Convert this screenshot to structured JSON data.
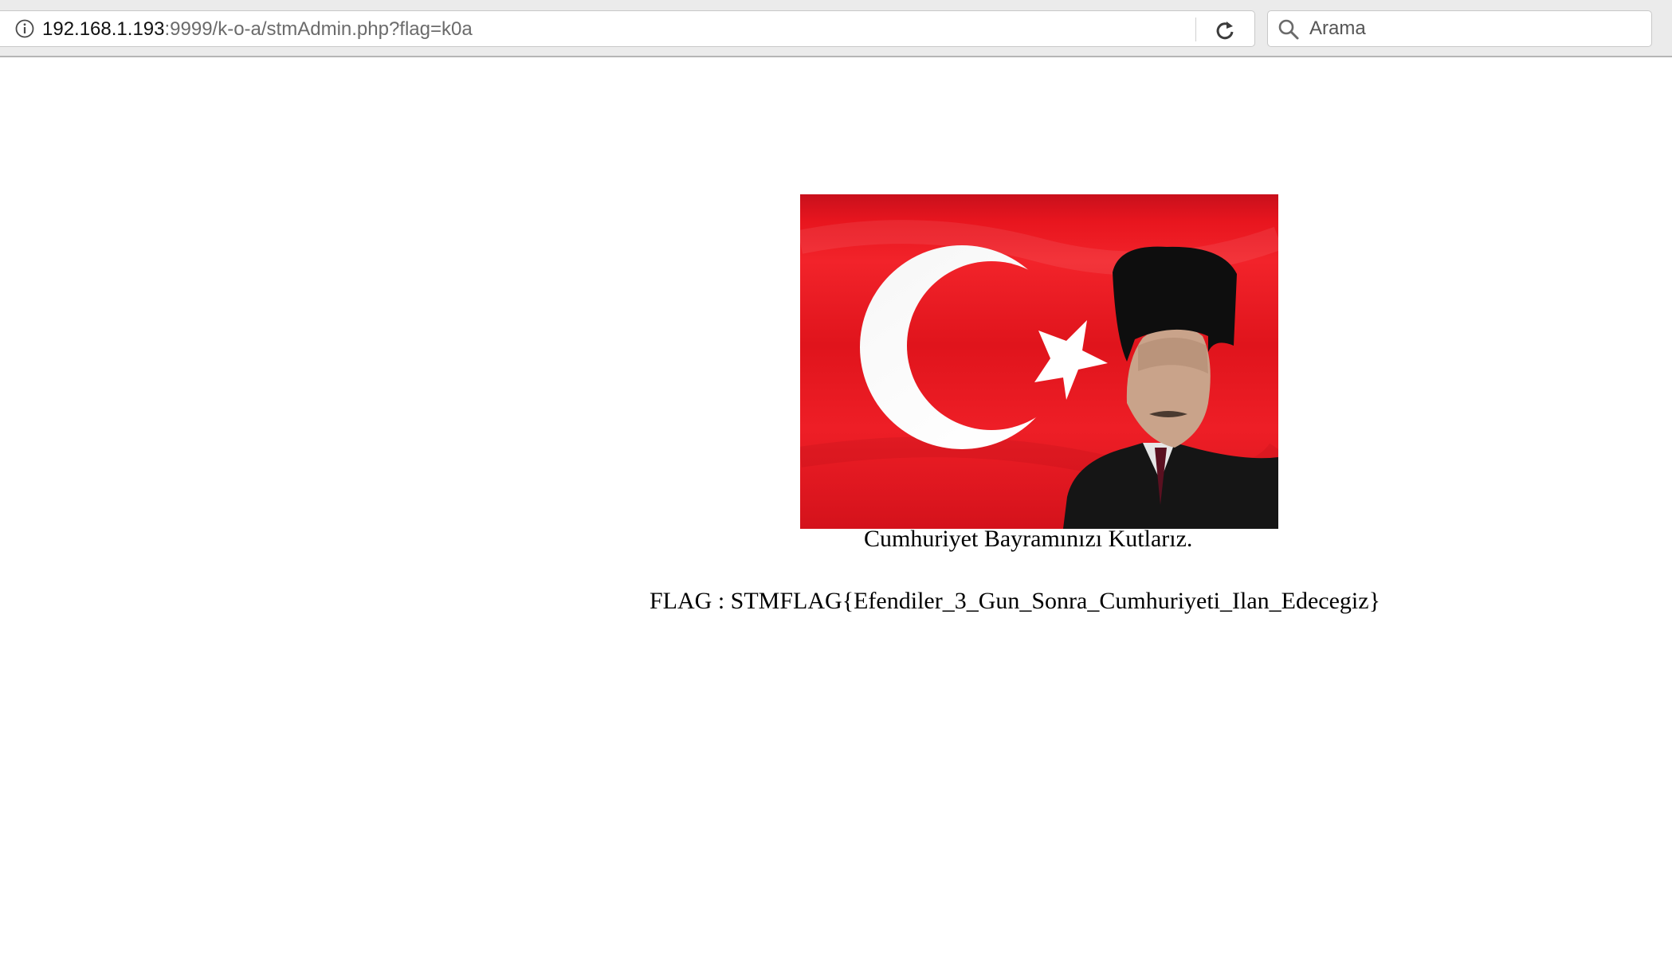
{
  "browser": {
    "url_host": "192.168.1.193",
    "url_rest": ":9999/k-o-a/stmAdmin.php?flag=k0a",
    "search_placeholder": "Arama"
  },
  "page": {
    "caption": "Cumhuriyet Bayramınızı Kutlarız.",
    "flag_text": "FLAG : STMFLAG{Efendiler_3_Gun_Sonra_Cumhuriyeti_Ilan_Edecegiz}"
  },
  "colors": {
    "flag_red": "#e30a17",
    "toolbar_bg": "#ebebeb"
  }
}
